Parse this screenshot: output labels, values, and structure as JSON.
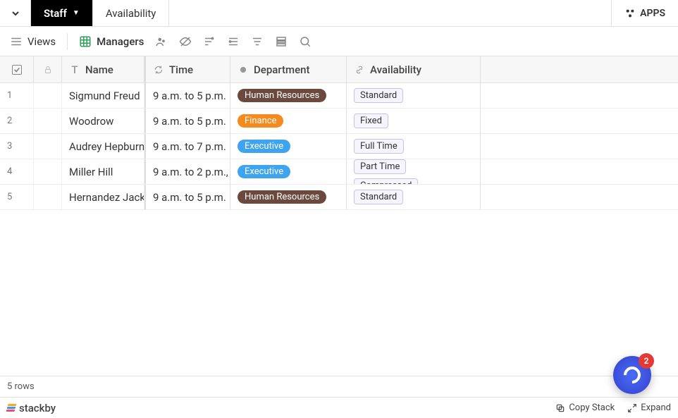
{
  "tabs": {
    "staff": "Staff",
    "availability": "Availability"
  },
  "apps_label": "APPS",
  "toolbar": {
    "views": "Views",
    "managers": "Managers"
  },
  "columns": {
    "name": "Name",
    "time": "Time",
    "dept": "Department",
    "avail": "Availability"
  },
  "dept_pills": {
    "hr": "Human Resources",
    "fin": "Finance",
    "exec": "Executive"
  },
  "avail_tags": {
    "standard": "Standard",
    "fixed": "Fixed",
    "fulltime": "Full Time",
    "parttime": "Part Time",
    "compressed": "Compressed"
  },
  "rows": [
    {
      "num": "1",
      "name": "Sigmund Freud",
      "time": "9 a.m. to 5 p.m."
    },
    {
      "num": "2",
      "name": "Woodrow",
      "time": "9 a.m. to 5 p.m."
    },
    {
      "num": "3",
      "name": "Audrey Hepburn",
      "time": "9 a.m. to 7 p.m."
    },
    {
      "num": "4",
      "name": "Miller Hill",
      "time": "9 a.m. to 2 p.m.,"
    },
    {
      "num": "5",
      "name": "Hernandez Jack",
      "time": "9 a.m. to 5 p.m."
    }
  ],
  "status": {
    "row_count": "5 rows"
  },
  "footer": {
    "brand": "stackby",
    "copy": "Copy Stack",
    "expand": "Expand"
  },
  "chat": {
    "badge": "2"
  }
}
